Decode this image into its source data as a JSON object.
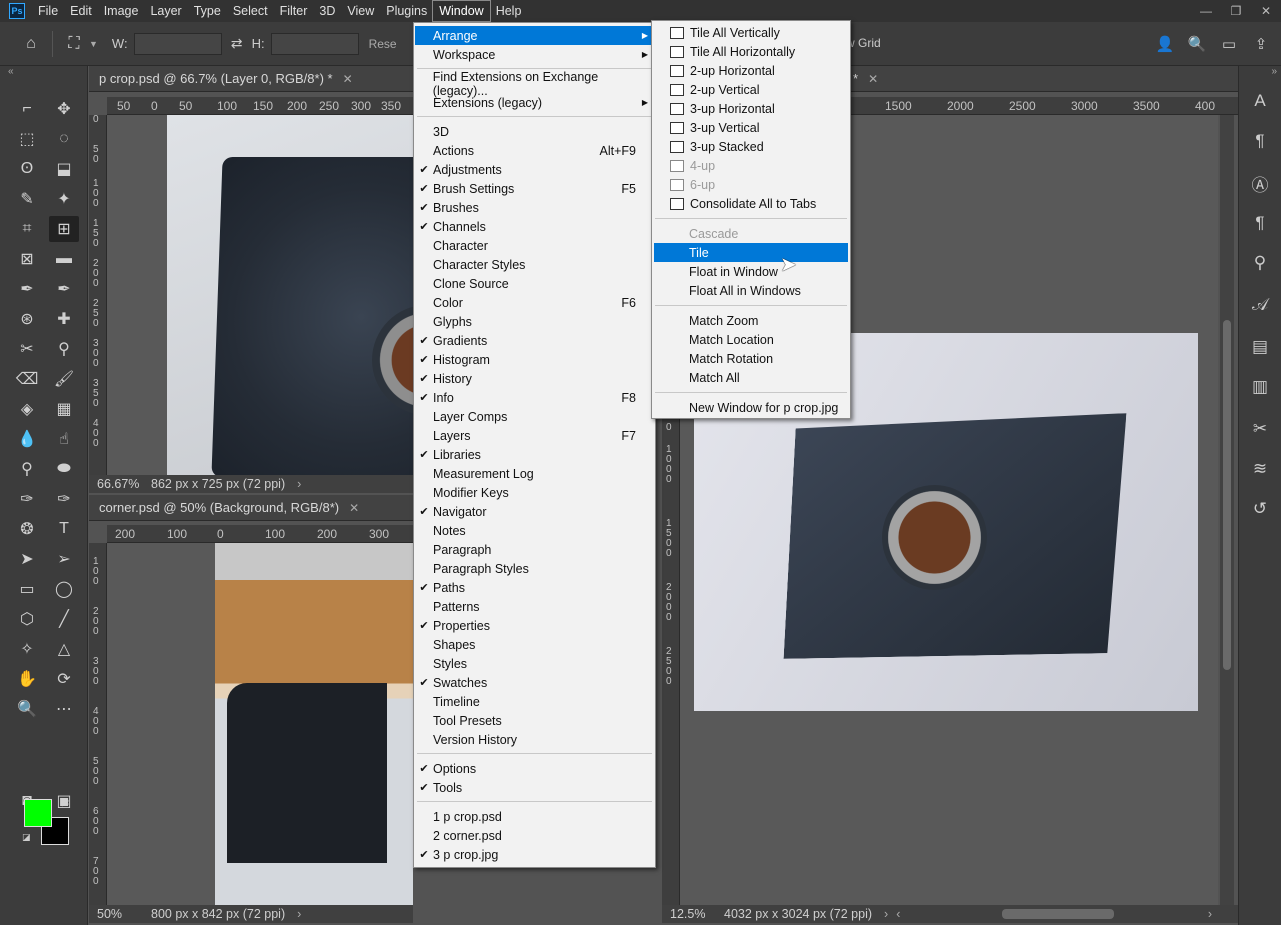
{
  "app": {
    "logo": "Ps"
  },
  "menubar": [
    "File",
    "Edit",
    "Image",
    "Layer",
    "Type",
    "Select",
    "Filter",
    "3D",
    "View",
    "Plugins",
    "Window",
    "Help"
  ],
  "window_controls": {
    "minimize": "—",
    "restore": "❐",
    "close": "✕"
  },
  "options": {
    "w_label": "W:",
    "h_label": "H:",
    "reset": "Rese",
    "view_grid": "w Grid"
  },
  "docs": {
    "doc1": {
      "tab": "p crop.psd @ 66.7% (Layer 0, RGB/8*) *",
      "zoom": "66.67%",
      "dims": "862 px x 725 px (72 ppi)",
      "ruler_h": [
        "50",
        "0",
        "50",
        "100",
        "150",
        "200",
        "250",
        "300",
        "350"
      ],
      "ruler_v": [
        "0",
        "5 0",
        "1 0 0",
        "1 5 0",
        "2 0 0",
        "2 5 0",
        "3 0 0",
        "3 5 0",
        "4 0 0"
      ]
    },
    "doc2": {
      "tab": "corner.psd @ 50% (Background, RGB/8*)",
      "zoom": "50%",
      "dims": "800 px x 842 px (72 ppi)",
      "ruler_h": [
        "200",
        "100",
        "0",
        "100",
        "200",
        "300"
      ],
      "ruler_v": [
        "1 0 0",
        "2 0 0",
        "3 0 0",
        "4 0 0",
        "5 0 0",
        "6 0 0",
        "7 0 0"
      ]
    },
    "doc3": {
      "tab": "*",
      "zoom": "12.5%",
      "dims": "4032 px x 3024 px (72 ppi)",
      "ruler_h": [
        "1500",
        "2000",
        "2500",
        "3000",
        "3500",
        "400"
      ],
      "ruler_v": [
        "0",
        "1 0 0 0",
        "1 5 0 0",
        "2 0 0 0",
        "2 5 0 0"
      ]
    }
  },
  "window_menu": {
    "items": [
      {
        "label": "Arrange",
        "submenu": true,
        "highlight": true
      },
      {
        "label": "Workspace",
        "submenu": true
      },
      {
        "sep": true
      },
      {
        "label": "Find Extensions on Exchange (legacy)..."
      },
      {
        "label": "Extensions (legacy)",
        "submenu": true
      },
      {
        "sep": true
      },
      {
        "label": "3D"
      },
      {
        "label": "Actions",
        "shortcut": "Alt+F9"
      },
      {
        "label": "Adjustments",
        "checked": true
      },
      {
        "label": "Brush Settings",
        "checked": true,
        "shortcut": "F5"
      },
      {
        "label": "Brushes",
        "checked": true
      },
      {
        "label": "Channels",
        "checked": true
      },
      {
        "label": "Character"
      },
      {
        "label": "Character Styles"
      },
      {
        "label": "Clone Source"
      },
      {
        "label": "Color",
        "shortcut": "F6"
      },
      {
        "label": "Glyphs"
      },
      {
        "label": "Gradients",
        "checked": true
      },
      {
        "label": "Histogram",
        "checked": true
      },
      {
        "label": "History",
        "checked": true
      },
      {
        "label": "Info",
        "checked": true,
        "shortcut": "F8"
      },
      {
        "label": "Layer Comps"
      },
      {
        "label": "Layers",
        "shortcut": "F7"
      },
      {
        "label": "Libraries",
        "checked": true
      },
      {
        "label": "Measurement Log"
      },
      {
        "label": "Modifier Keys"
      },
      {
        "label": "Navigator",
        "checked": true
      },
      {
        "label": "Notes"
      },
      {
        "label": "Paragraph"
      },
      {
        "label": "Paragraph Styles"
      },
      {
        "label": "Paths",
        "checked": true
      },
      {
        "label": "Patterns"
      },
      {
        "label": "Properties",
        "checked": true
      },
      {
        "label": "Shapes"
      },
      {
        "label": "Styles"
      },
      {
        "label": "Swatches",
        "checked": true
      },
      {
        "label": "Timeline"
      },
      {
        "label": "Tool Presets"
      },
      {
        "label": "Version History"
      },
      {
        "sep": true
      },
      {
        "label": "Options",
        "checked": true
      },
      {
        "label": "Tools",
        "checked": true
      },
      {
        "sep": true
      },
      {
        "label": "1 p crop.psd"
      },
      {
        "label": "2 corner.psd"
      },
      {
        "label": "3 p crop.jpg",
        "checked": true
      }
    ]
  },
  "arrange_menu": {
    "items": [
      {
        "label": "Tile All Vertically",
        "icon": "tile-vertical-icon"
      },
      {
        "label": "Tile All Horizontally",
        "icon": "tile-horizontal-icon"
      },
      {
        "label": "2-up Horizontal",
        "icon": "two-up-horizontal-icon"
      },
      {
        "label": "2-up Vertical",
        "icon": "two-up-vertical-icon"
      },
      {
        "label": "3-up Horizontal",
        "icon": "three-up-horizontal-icon"
      },
      {
        "label": "3-up Vertical",
        "icon": "three-up-vertical-icon"
      },
      {
        "label": "3-up Stacked",
        "icon": "three-up-stacked-icon"
      },
      {
        "label": "4-up",
        "icon": "four-up-icon",
        "disabled": true
      },
      {
        "label": "6-up",
        "icon": "six-up-icon",
        "disabled": true
      },
      {
        "label": "Consolidate All to Tabs",
        "icon": "consolidate-tabs-icon"
      },
      {
        "sep": true
      },
      {
        "label": "Cascade",
        "disabled": true
      },
      {
        "label": "Tile",
        "highlight": true
      },
      {
        "label": "Float in Window"
      },
      {
        "label": "Float All in Windows"
      },
      {
        "sep": true
      },
      {
        "label": "Match Zoom"
      },
      {
        "label": "Match Location"
      },
      {
        "label": "Match Rotation"
      },
      {
        "label": "Match All"
      },
      {
        "sep": true
      },
      {
        "label": "New Window for p crop.jpg"
      }
    ]
  },
  "colors": {
    "foreground": "#00ff00",
    "background": "#000000",
    "highlight": "#0078d7"
  }
}
